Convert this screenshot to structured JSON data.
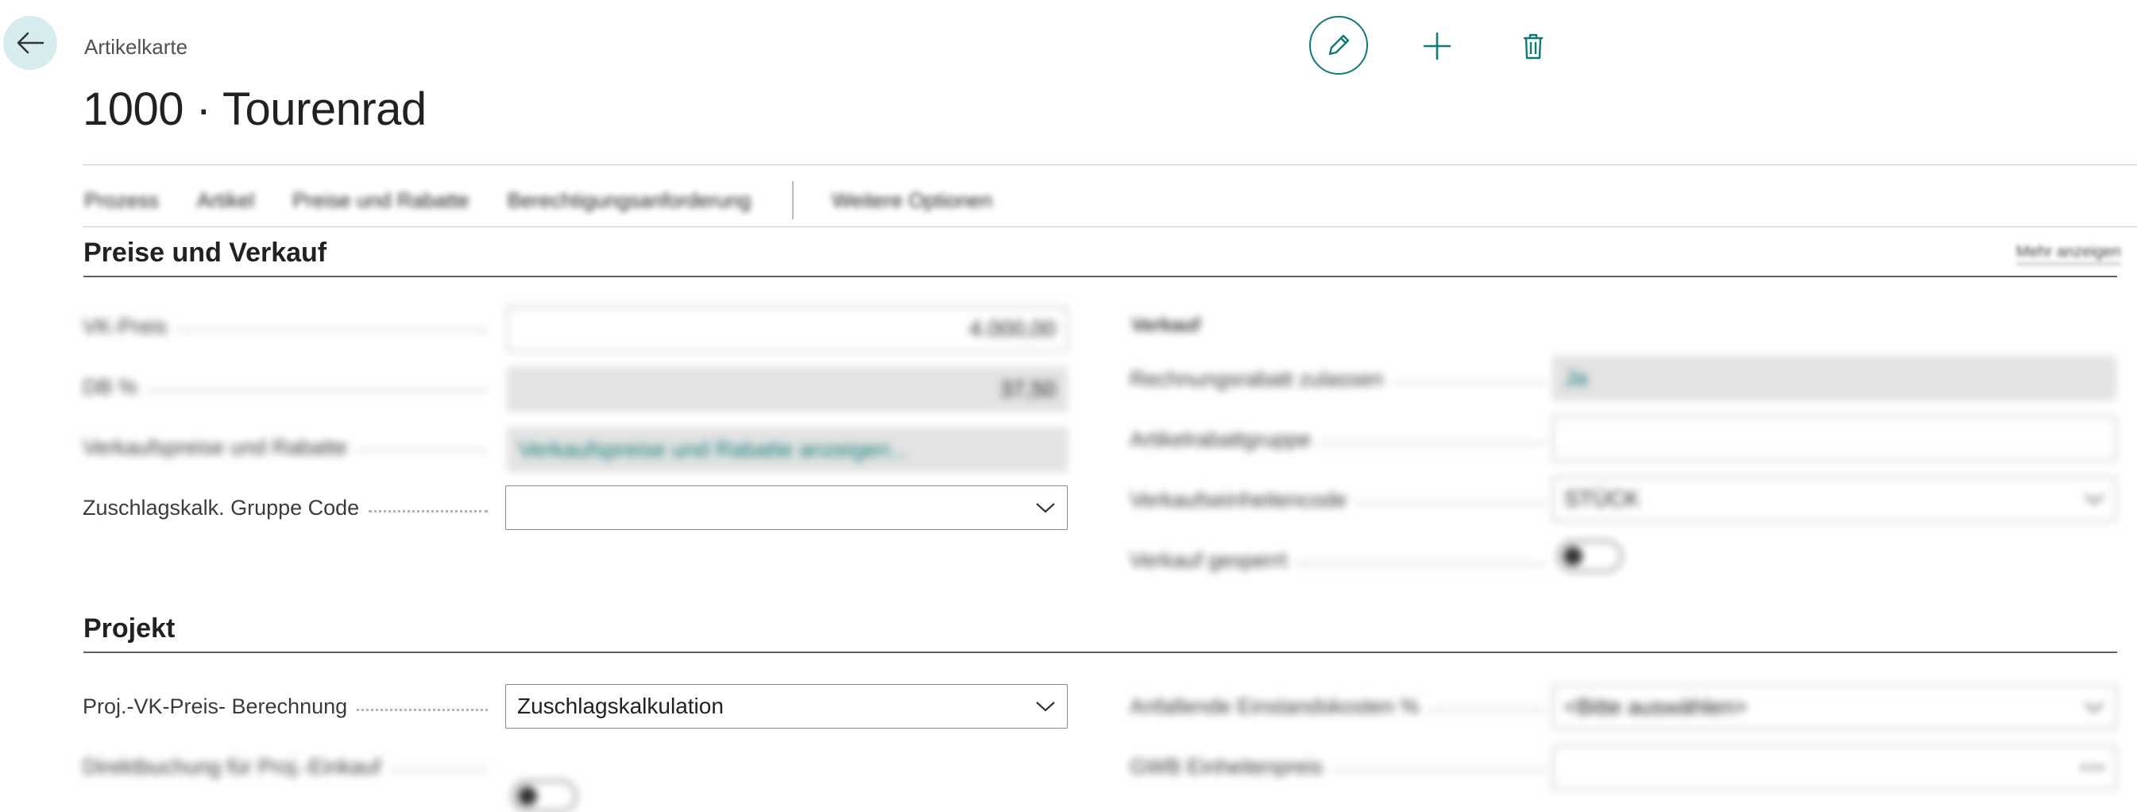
{
  "header": {
    "page_caption": "Artikelkarte",
    "title": "1000 · Tourenrad"
  },
  "actions": {
    "items": [
      "Prozess",
      "Artikel",
      "Preise und Rabatte",
      "Berechtigungsanforderung"
    ],
    "more": "Weitere Optionen"
  },
  "section_sales": {
    "title": "Preise und Verkauf",
    "show_more": "Mehr anzeigen",
    "left_fields": [
      {
        "label": "VK-Preis",
        "value": "4.000,00"
      },
      {
        "label": "DB %",
        "value": "37,50"
      },
      {
        "label": "Verkaufspreise und Rabatte",
        "value": "Verkaufspreise und Rabatte anzeigen..."
      },
      {
        "label": "Zuschlagskalk. Gruppe Code",
        "value": ""
      }
    ],
    "right_group_title": "Verkauf",
    "right_fields": [
      {
        "label": "Rechnungsrabatt zulassen",
        "value": "Ja"
      },
      {
        "label": "Artikelrabattgruppe",
        "value": ""
      },
      {
        "label": "Verkaufseinheitencode",
        "value": "STÜCK"
      },
      {
        "label": "Verkauf gesperrt",
        "value": ""
      }
    ]
  },
  "section_project": {
    "title": "Projekt",
    "left_fields": [
      {
        "label": "Proj.-VK-Preis- Berechnung",
        "value": "Zuschlagskalkulation"
      },
      {
        "label": "Direktbuchung für Proj.-Einkauf",
        "value": ""
      }
    ],
    "right_fields": [
      {
        "label": "Anfallende Einstandskosten %",
        "value": "<Bitte auswählen>"
      },
      {
        "label": "GWB Einheitenpreis",
        "value": ""
      }
    ]
  },
  "colors": {
    "accent": "#0e7a78",
    "back_bg": "#d7ecef",
    "readonly_bg": "#e3e3e3"
  },
  "icons": {
    "back": "arrow-left-icon",
    "edit": "pencil-icon",
    "new": "plus-icon",
    "delete": "trash-icon",
    "dropdown": "chevron-down-icon"
  }
}
